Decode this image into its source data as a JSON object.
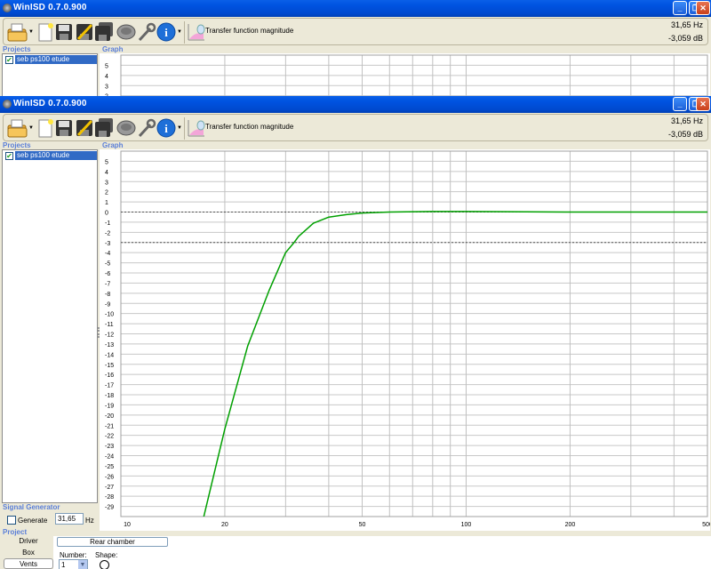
{
  "window": {
    "title": "WinISD 0.7.0.900",
    "minimize_label": "_",
    "restore_label": "❐",
    "close_label": "✕"
  },
  "toolbar": {
    "icons": [
      "open-folder-icon",
      "new-document-icon",
      "save-icon",
      "save-as-icon",
      "save-all-icon",
      "driver-icon",
      "wrench-icon",
      "info-icon",
      "chart-icon"
    ],
    "graph_type": "Transfer function magnitude",
    "readout_freq": "31,65 Hz",
    "readout_level": "-3,059 dB"
  },
  "projects": {
    "label": "Projects",
    "items": [
      {
        "name": "seb ps100 etude",
        "checked": true,
        "selected": true
      }
    ]
  },
  "graph": {
    "label": "Graph"
  },
  "signal_generator": {
    "label": "Signal Generator",
    "generate_label": "Generate",
    "generate_checked": false,
    "frequency_value": "31,65",
    "unit": "Hz"
  },
  "project": {
    "label": "Project",
    "tabs": [
      {
        "label": "Driver"
      },
      {
        "label": "Box"
      },
      {
        "label": "Vents",
        "selected": true
      }
    ],
    "rear_chamber_label": "Rear chamber",
    "number_label": "Number:",
    "number_value": "1",
    "shape_label": "Shape:"
  },
  "colors": {
    "curve": "#00A000",
    "titlebar": "#0053E1",
    "selection": "#316AC5",
    "group_label": "#5B7FD8"
  },
  "chart_data": {
    "type": "line",
    "title": "",
    "xlabel": "",
    "ylabel": "",
    "xscale": "log",
    "xlim": [
      10,
      500
    ],
    "ylim": [
      -30,
      6
    ],
    "grid": true,
    "x_ticks": [
      10,
      20,
      50,
      100,
      200,
      500
    ],
    "x_gridlines": [
      10,
      20,
      30,
      40,
      50,
      60,
      70,
      80,
      90,
      100,
      200,
      300,
      400,
      500
    ],
    "y_ticks": [
      5,
      4,
      3,
      2,
      1,
      0,
      -1,
      -2,
      -3,
      -4,
      -5,
      -6,
      -7,
      -8,
      -9,
      -10,
      -11,
      -12,
      -13,
      -14,
      -15,
      -16,
      -17,
      -18,
      -19,
      -20,
      -21,
      -22,
      -23,
      -24,
      -25,
      -26,
      -27,
      -28,
      -29
    ],
    "reference_lines": [
      0,
      -3
    ],
    "series": [
      {
        "x": [
          17.3,
          20,
          23.3,
          26.9,
          30,
          31.65,
          32.7,
          36.1,
          40,
          45,
          50,
          60,
          80,
          100,
          200,
          500
        ],
        "y": [
          -30.3,
          -21.4,
          -13.2,
          -7.7,
          -4.0,
          -3.06,
          -2.4,
          -1.1,
          -0.5,
          -0.25,
          -0.1,
          0,
          0.05,
          0.05,
          0,
          0
        ]
      }
    ]
  }
}
